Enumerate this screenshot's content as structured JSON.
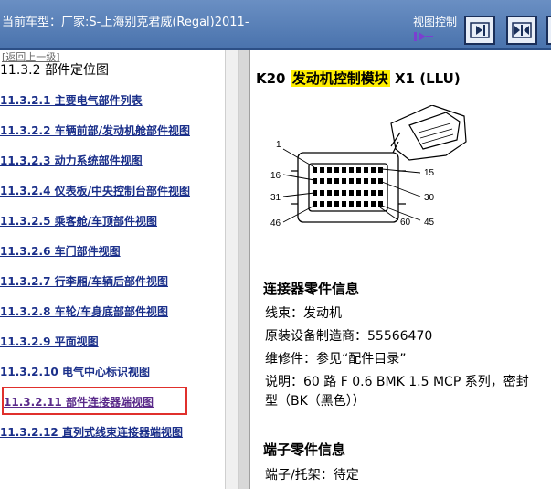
{
  "header": {
    "vehicle": "当前车型：厂家:S-上海别克君威(Regal)2011-",
    "view_control_label": "视图控制"
  },
  "left": {
    "back_link": "[返回上一级]",
    "section_title": "11.3.2 部件定位图",
    "items": [
      {
        "label": "11.3.2.1 主要电气部件列表"
      },
      {
        "label": "11.3.2.2 车辆前部/发动机舱部件视图"
      },
      {
        "label": "11.3.2.3 动力系统部件视图"
      },
      {
        "label": "11.3.2.4 仪表板/中央控制台部件视图"
      },
      {
        "label": "11.3.2.5 乘客舱/车顶部件视图"
      },
      {
        "label": "11.3.2.6 车门部件视图"
      },
      {
        "label": "11.3.2.7 行李厢/车辆后部件视图"
      },
      {
        "label": "11.3.2.8 车轮/车身底部部件视图"
      },
      {
        "label": "11.3.2.9 平面视图"
      },
      {
        "label": "11.3.2.10 电气中心标识视图"
      },
      {
        "label": "11.3.2.11 部件连接器端视图"
      },
      {
        "label": "11.3.2.12 直列式线束连接器端视图"
      }
    ]
  },
  "right": {
    "k_code": "K20",
    "k_name": "发动机控制模块",
    "k_suffix": "X1 (LLU)",
    "pins": {
      "p1": "1",
      "p15": "15",
      "p16": "16",
      "p30": "30",
      "p31": "31",
      "p45": "45",
      "p46": "46",
      "p60": "60"
    },
    "connector_info_title": "连接器零件信息",
    "harness": "线束：发动机",
    "oem": "原装设备制造商：55566470",
    "service": "维修件：参见“配件目录”",
    "desc_1": "说明：60 路 F 0.6 BMK 1.5 MCP 系列，密封",
    "desc_2": "型（BK（黑色））",
    "terminal_title": "端子零件信息",
    "terminal_line": "端子/托架：待定"
  },
  "colors": {
    "accent": "#4a73ad",
    "link": "#1a2f8a",
    "highlight": "#ffee00",
    "selection_box": "#e0302c"
  }
}
